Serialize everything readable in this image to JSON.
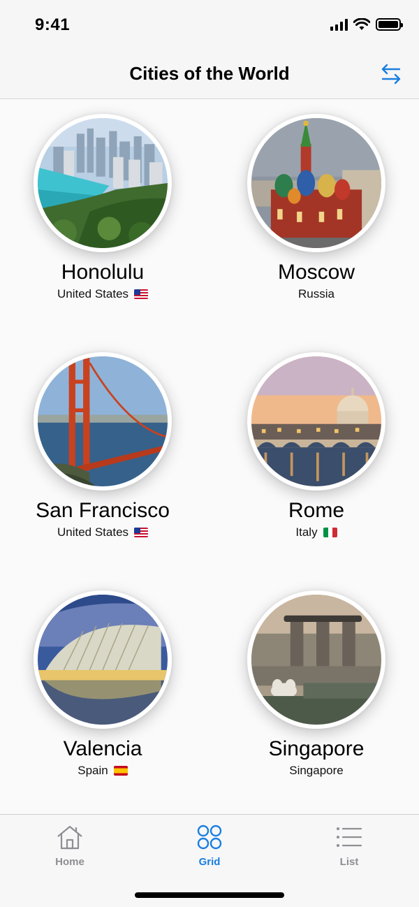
{
  "status_bar": {
    "time": "9:41"
  },
  "nav": {
    "title": "Cities of the World",
    "swap_icon": "swap-arrows-icon"
  },
  "colors": {
    "accent": "#1a7ee0",
    "tab_inactive": "#8e8e93"
  },
  "cities": [
    {
      "name": "Honolulu",
      "country": "United States",
      "flag": "us-flag-icon"
    },
    {
      "name": "Moscow",
      "country": "Russia",
      "flag": ""
    },
    {
      "name": "San Francisco",
      "country": "United States",
      "flag": "us-flag-icon"
    },
    {
      "name": "Rome",
      "country": "Italy",
      "flag": "italy-flag-icon"
    },
    {
      "name": "Valencia",
      "country": "Spain",
      "flag": "spain-flag-icon"
    },
    {
      "name": "Singapore",
      "country": "Singapore",
      "flag": ""
    }
  ],
  "tabs": [
    {
      "label": "Home",
      "icon": "home-icon",
      "active": false
    },
    {
      "label": "Grid",
      "icon": "grid-icon",
      "active": true
    },
    {
      "label": "List",
      "icon": "list-icon",
      "active": false
    }
  ]
}
